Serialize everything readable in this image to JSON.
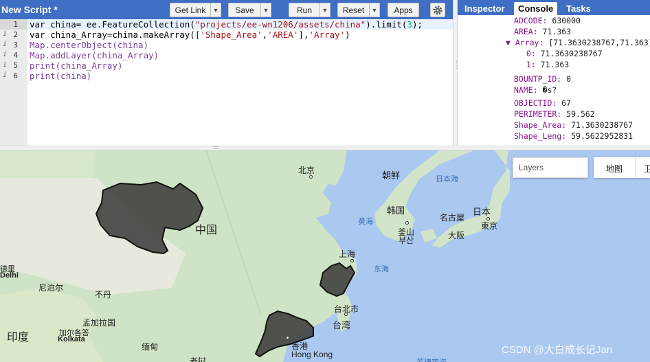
{
  "editor": {
    "title": "New Script *",
    "buttons": {
      "get_link": "Get Link",
      "save": "Save",
      "run": "Run",
      "reset": "Reset",
      "apps": "Apps"
    },
    "lines": [
      {
        "num": "1",
        "warn": ""
      },
      {
        "num": "2",
        "warn": "i"
      },
      {
        "num": "3",
        "warn": "i"
      },
      {
        "num": "4",
        "warn": "i"
      },
      {
        "num": "5",
        "warn": "i"
      },
      {
        "num": "6",
        "warn": "i"
      }
    ],
    "code": {
      "l1_a": "var china= ",
      "l1_b": "ee.FeatureCollection(",
      "l1_c": "\"projects/ee-wn1206/assets/china\"",
      "l1_d": ").limit(",
      "l1_e": "3",
      "l1_f": ");",
      "l2_a": "var china_Array=china.makeArray([",
      "l2_b": "'Shape_Area'",
      "l2_c": ",",
      "l2_d": "'AREA'",
      "l2_e": "],",
      "l2_f": "'Array'",
      "l2_g": ")",
      "l3_a": "Map",
      "l3_b": ".centerObject(china)",
      "l4_a": "Map",
      "l4_b": ".addLayer(china_Array)",
      "l5_a": "print",
      "l5_b": "(china_Array)",
      "l6_a": "print",
      "l6_b": "(china)"
    }
  },
  "panel": {
    "tabs": {
      "inspector": "Inspector",
      "console": "Console",
      "tasks": "Tasks"
    },
    "console": [
      {
        "key": "ADCODE:",
        "val": " 630000"
      },
      {
        "key": "AREA:",
        "val": " 71.363"
      },
      {
        "key": "▼ Array:",
        "val": " [71.3630238767,71.363]"
      },
      {
        "key": "  0:",
        "val": " 71.3630238767"
      },
      {
        "key": "  1:",
        "val": " 71.363"
      },
      {
        "key": "BOUNTP_ID:",
        "val": " 0"
      },
      {
        "key": "NAME:",
        "val": " �s?"
      },
      {
        "key": "OBJECTID:",
        "val": " 67"
      },
      {
        "key": "PERIMETER:",
        "val": " 59.562"
      },
      {
        "key": "Shape_Area:",
        "val": " 71.3630238767"
      },
      {
        "key": "Shape_Leng:",
        "val": " 59.5622952831"
      }
    ]
  },
  "map": {
    "layers_label": "Layers",
    "map_type": "地图",
    "map_type2": "卫",
    "labels": {
      "beijing": "北京",
      "korea_n": "朝鲜",
      "japan_sea": "日本海",
      "korea_s": "韩国",
      "yellow_sea": "黄海",
      "busan": "釜山",
      "busan_ko": "부산",
      "nagoya": "名古屋",
      "osaka": "大阪",
      "japan": "日本",
      "tokyo": "東京",
      "china": "中国",
      "shanghai": "上海",
      "east_sea": "东海",
      "taipei": "台北市",
      "taiwan": "台湾",
      "nepal": "尼泊尔",
      "bhutan": "不丹",
      "bangladesh": "孟加拉国",
      "kolkata_cn": "加尔各答",
      "kolkata": "Kolkata",
      "india": "印度",
      "myanmar": "缅甸",
      "hongkong_cn": "香港",
      "hongkong": "Hong Kong",
      "delhi": "Delhi",
      "delhi_cn": "德里",
      "laos": "老挝",
      "south_sea": "菲律宾海"
    },
    "colors": {
      "water": "#aac8f0",
      "land": "#cfe3c6",
      "polygon": "#3e3e3a"
    }
  },
  "watermark": "CSDN @大白成长记Jan"
}
